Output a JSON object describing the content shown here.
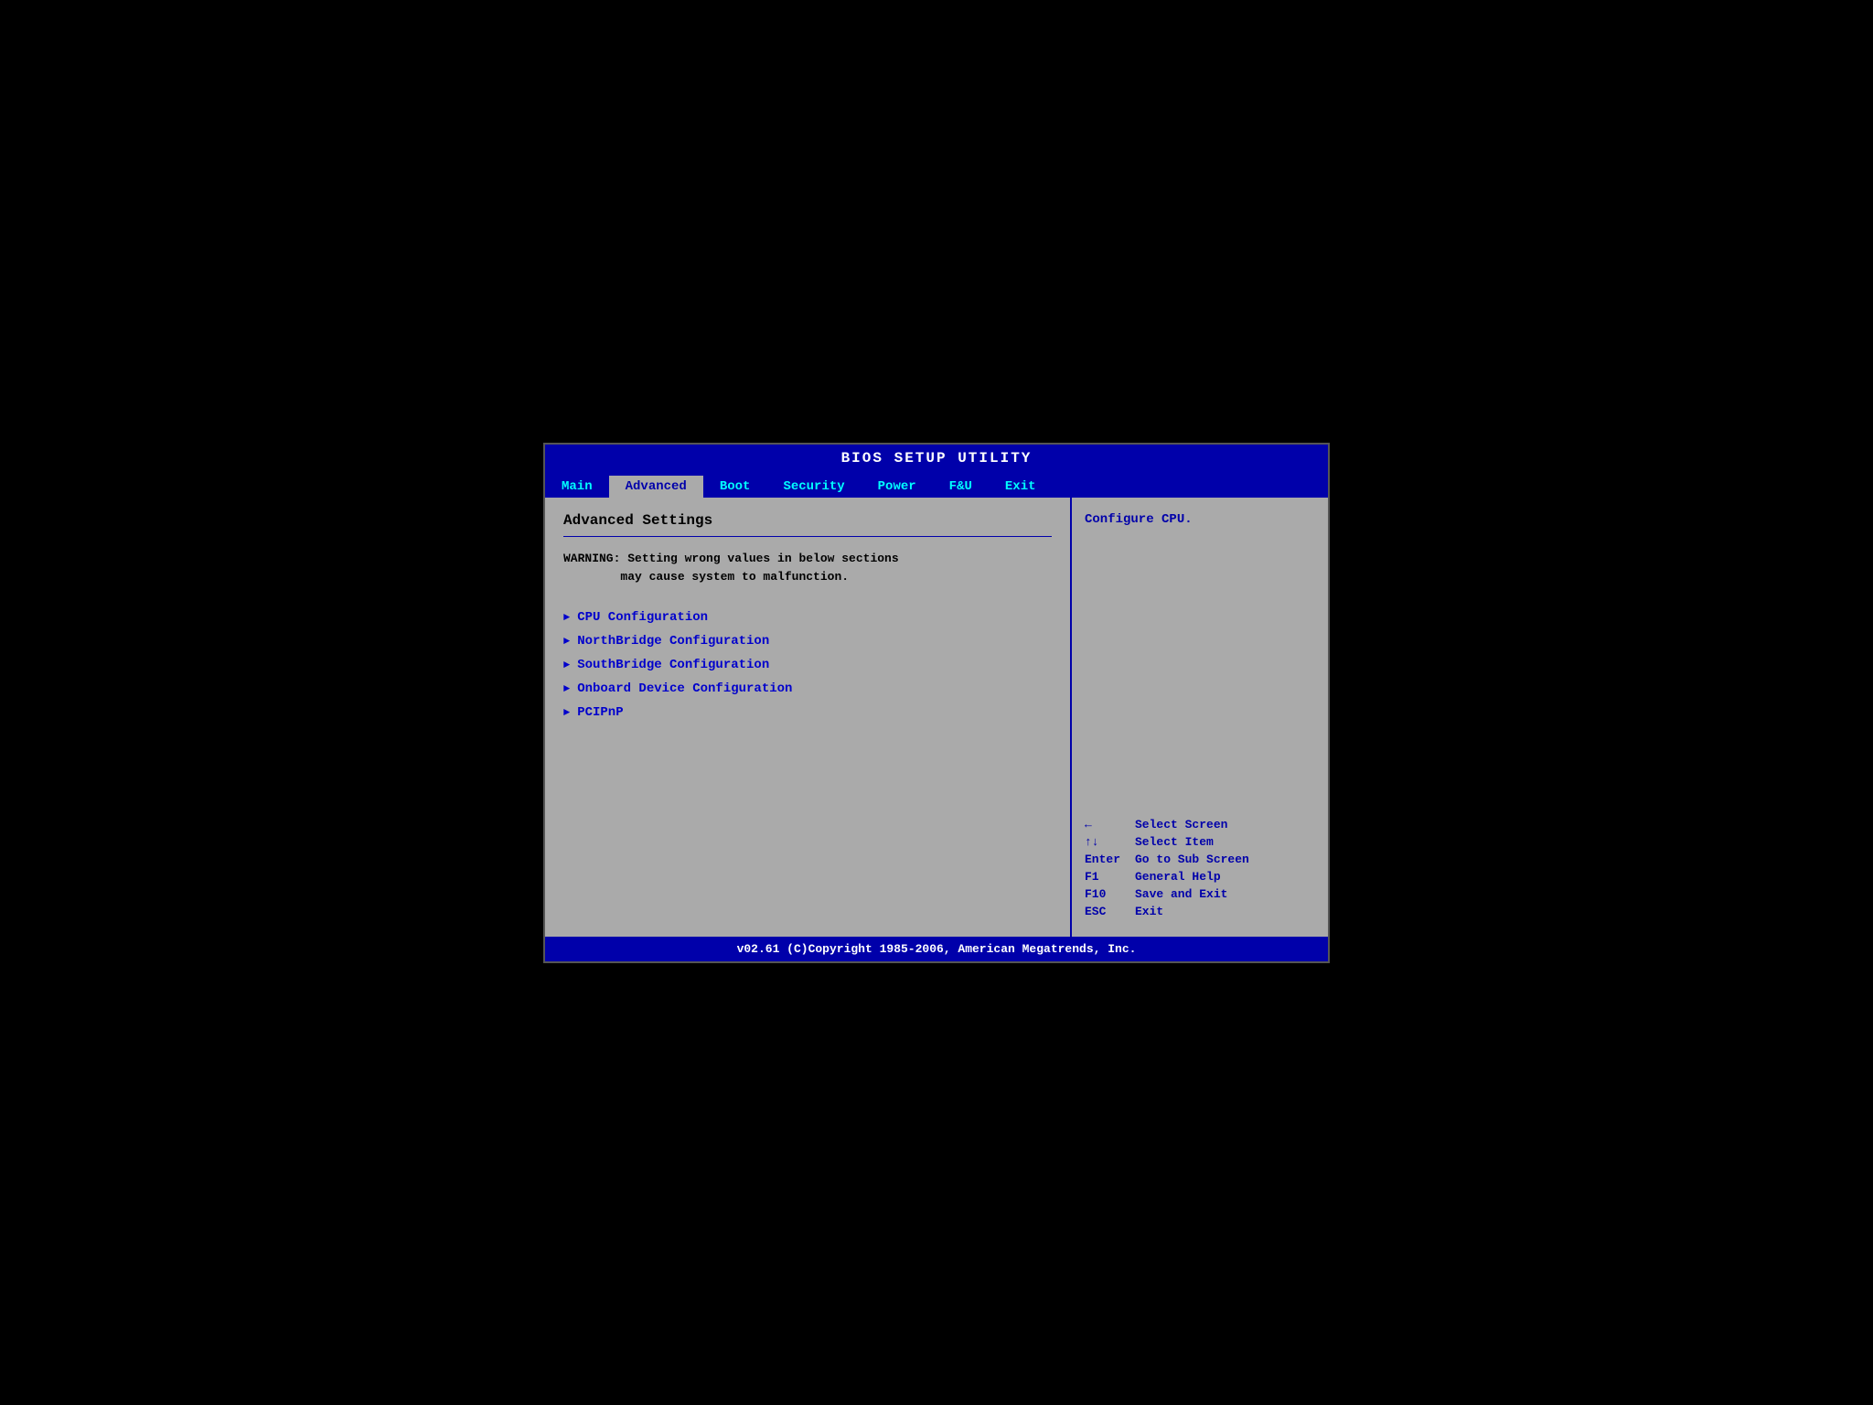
{
  "title": "BIOS SETUP UTILITY",
  "nav": {
    "items": [
      {
        "label": "Main",
        "active": false
      },
      {
        "label": "Advanced",
        "active": true
      },
      {
        "label": "Boot",
        "active": false
      },
      {
        "label": "Security",
        "active": false
      },
      {
        "label": "Power",
        "active": false
      },
      {
        "label": "F&U",
        "active": false
      },
      {
        "label": "Exit",
        "active": false
      }
    ]
  },
  "left": {
    "section_title": "Advanced Settings",
    "warning": "WARNING: Setting wrong values in below sections\n        may cause system to malfunction.",
    "menu_items": [
      {
        "label": "CPU Configuration"
      },
      {
        "label": "NorthBridge Configuration"
      },
      {
        "label": "SouthBridge Configuration"
      },
      {
        "label": "Onboard Device Configuration"
      },
      {
        "label": "PCIPnP"
      }
    ]
  },
  "right": {
    "help_text": "Configure CPU.",
    "keys": [
      {
        "key": "←",
        "desc": "Select Screen"
      },
      {
        "key": "↑↓",
        "desc": "Select Item"
      },
      {
        "key": "Enter",
        "desc": "Go to Sub Screen"
      },
      {
        "key": "F1",
        "desc": "General Help"
      },
      {
        "key": "F10",
        "desc": "Save and Exit"
      },
      {
        "key": "ESC",
        "desc": "Exit"
      }
    ]
  },
  "footer": "v02.61 (C)Copyright 1985-2006, American Megatrends, Inc."
}
